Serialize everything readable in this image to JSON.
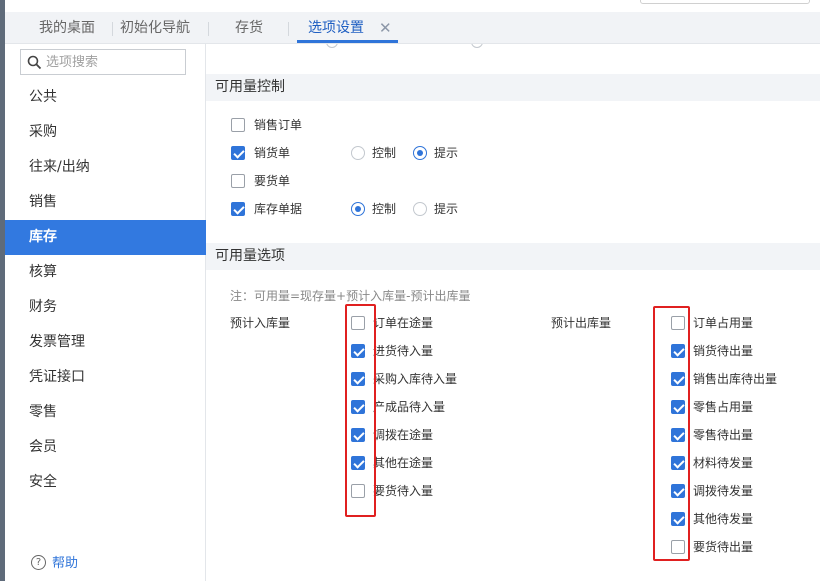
{
  "tabs": [
    "我的桌面",
    "初始化导航",
    "存货",
    "选项设置"
  ],
  "active_tab": "选项设置",
  "close_icon": "close-icon",
  "search": {
    "placeholder": "选项搜索",
    "icon": "search-icon"
  },
  "sidebar": {
    "items": [
      "公共",
      "采购",
      "往来/出纳",
      "销售",
      "库存",
      "核算",
      "财务",
      "发票管理",
      "凭证接口",
      "零售",
      "会员",
      "安全"
    ],
    "active": "库存"
  },
  "help": {
    "label": "帮助",
    "icon": "help-icon"
  },
  "availability_control": {
    "title": "可用量控制",
    "rows": [
      {
        "label": "销售订单",
        "checked": false
      },
      {
        "label": "销货单",
        "checked": true,
        "mode": "提示"
      },
      {
        "label": "要货单",
        "checked": false
      },
      {
        "label": "库存单据",
        "checked": true,
        "mode": "控制"
      }
    ],
    "options": {
      "control": "控制",
      "hint": "提示"
    }
  },
  "availability_options": {
    "title": "可用量选项",
    "note": "注：可用量=现存量+预计入库量-预计出库量",
    "inbound": {
      "label": "预计入库量",
      "items": [
        {
          "label": "订单在途量",
          "checked": false
        },
        {
          "label": "进货待入量",
          "checked": true
        },
        {
          "label": "采购入库待入量",
          "checked": true
        },
        {
          "label": "产成品待入量",
          "checked": true
        },
        {
          "label": "调拨在途量",
          "checked": true
        },
        {
          "label": "其他在途量",
          "checked": true
        },
        {
          "label": "要货待入量",
          "checked": false
        }
      ]
    },
    "outbound": {
      "label": "预计出库量",
      "items": [
        {
          "label": "订单占用量",
          "checked": false
        },
        {
          "label": "销货待出量",
          "checked": true
        },
        {
          "label": "销售出库待出量",
          "checked": true
        },
        {
          "label": "零售占用量",
          "checked": true
        },
        {
          "label": "零售待出量",
          "checked": true
        },
        {
          "label": "材料待发量",
          "checked": true
        },
        {
          "label": "调拨待发量",
          "checked": true
        },
        {
          "label": "其他待发量",
          "checked": true
        },
        {
          "label": "要货待出量",
          "checked": false
        }
      ]
    }
  },
  "colors": {
    "accent": "#2f74d9",
    "sidebar_active": "#3279e0",
    "highlight_box": "#e02020"
  }
}
